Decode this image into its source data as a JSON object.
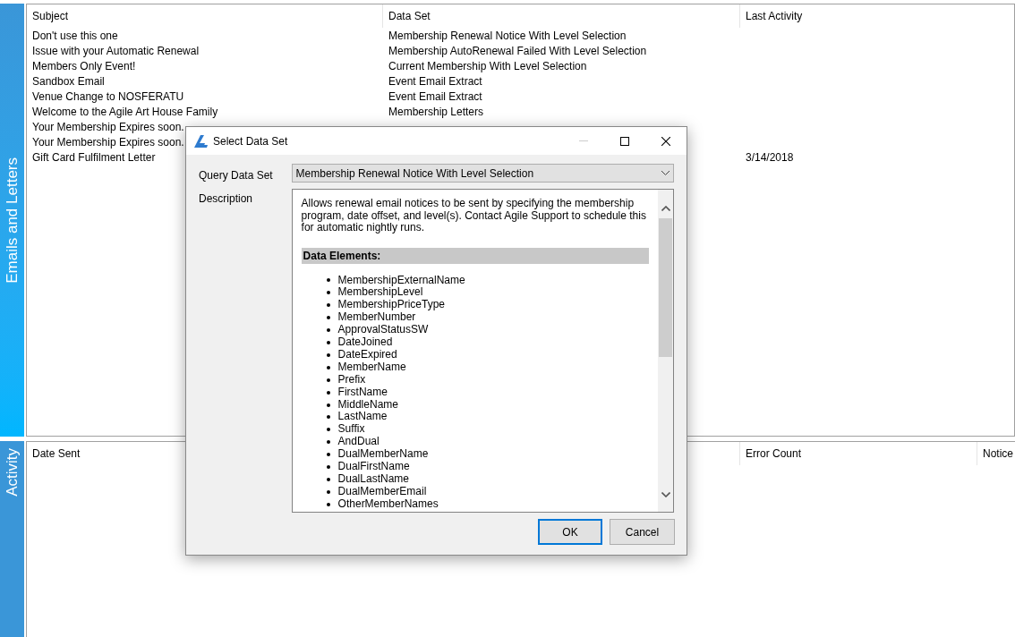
{
  "emails_panel": {
    "tab": "Emails and Letters",
    "columns": [
      "Subject",
      "Data Set",
      "Last Activity"
    ],
    "rows": [
      [
        "Don't use this one",
        "Membership Renewal Notice With Level Selection",
        ""
      ],
      [
        "Issue with your Automatic Renewal",
        "Membership AutoRenewal Failed With Level Selection",
        ""
      ],
      [
        "Members Only Event!",
        "Current Membership With Level Selection",
        ""
      ],
      [
        "Sandbox Email",
        "Event Email Extract",
        ""
      ],
      [
        "Venue Change to NOSFERATU",
        "Event Email Extract",
        ""
      ],
      [
        "Welcome to the Agile Art House Family",
        "Membership Letters",
        ""
      ],
      [
        "Your Membership Expires soon.",
        "",
        ""
      ],
      [
        "Your Membership Expires soon.",
        "",
        ""
      ],
      [
        "Gift Card Fulfilment Letter",
        "",
        "3/14/2018"
      ]
    ]
  },
  "activity_panel": {
    "tab": "Activity",
    "columns": [
      "Date Sent",
      "Error Count",
      "Notice"
    ]
  },
  "dialog": {
    "title": "Select Data Set",
    "query_label": "Query Data Set",
    "query_value": "Membership Renewal Notice With Level Selection",
    "description_label": "Description",
    "description": "Allows renewal email notices to be sent by specifying the membership program, date offset, and level(s). Contact Agile Support to schedule this for automatic nightly runs.",
    "elements_heading": "Data Elements:",
    "elements": [
      "MembershipExternalName",
      "MembershipLevel",
      "MembershipPriceType",
      "MemberNumber",
      "ApprovalStatusSW",
      "DateJoined",
      "DateExpired",
      "MemberName",
      "Prefix",
      "FirstName",
      "MiddleName",
      "LastName",
      "Suffix",
      "AndDual",
      "DualMemberName",
      "DualFirstName",
      "DualLastName",
      "DualMemberEmail",
      "OtherMemberNames"
    ],
    "buttons": [
      {
        "label": "OK",
        "default": true
      },
      {
        "label": "Cancel",
        "default": false
      }
    ]
  }
}
